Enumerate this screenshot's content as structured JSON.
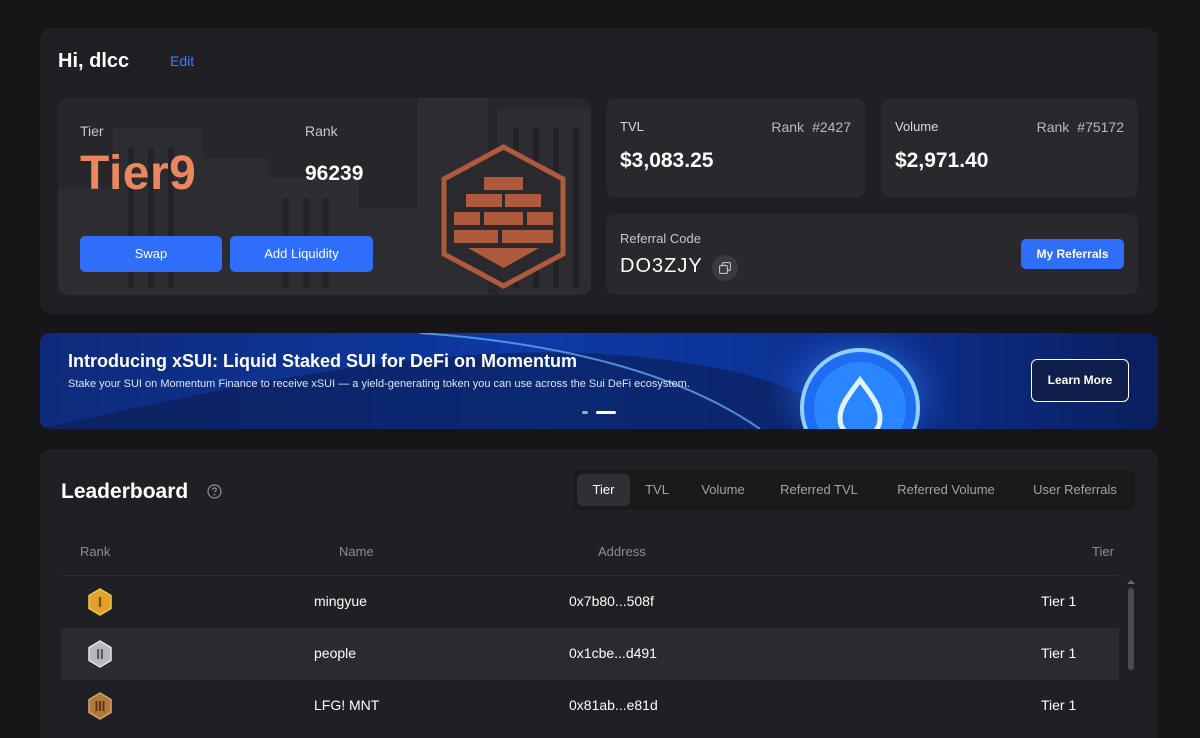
{
  "profile": {
    "greeting": "Hi, dlcc",
    "edit_label": "Edit",
    "tier_label": "Tier",
    "tier_value": "Tier9",
    "rank_label": "Rank",
    "rank_value": "96239",
    "swap_label": "Swap",
    "add_liquidity_label": "Add Liquidity"
  },
  "tvl": {
    "label": "TVL",
    "rank_label": "Rank",
    "rank_value": "#2427",
    "value": "$3,083.25"
  },
  "volume": {
    "label": "Volume",
    "rank_label": "Rank",
    "rank_value": "#75172",
    "value": "$2,971.40"
  },
  "referral": {
    "label": "Referral Code",
    "code": "DO3ZJY",
    "button_label": "My Referrals"
  },
  "banner": {
    "title": "Introducing xSUI: Liquid Staked SUI for DeFi on Momentum",
    "subtitle": "Stake your SUI on Momentum Finance to receive xSUI — a yield-generating token you can use across the Sui DeFi ecosystem.",
    "button_label": "Learn More"
  },
  "leaderboard": {
    "title": "Leaderboard",
    "tabs": [
      "Tier",
      "TVL",
      "Volume",
      "Referred TVL",
      "Referred Volume",
      "User Referrals"
    ],
    "active_tab": "Tier",
    "columns": [
      "Rank",
      "Name",
      "Address",
      "Tier"
    ],
    "rows": [
      {
        "medal": "gold-medal-icon",
        "name": "mingyue",
        "address": "0x7b80...508f",
        "tier": "Tier 1"
      },
      {
        "medal": "silver-medal-icon",
        "name": "people",
        "address": "0x1cbe...d491",
        "tier": "Tier 1"
      },
      {
        "medal": "bronze-medal-icon",
        "name": "LFG! MNT",
        "address": "0x81ab...e81d",
        "tier": "Tier 1"
      }
    ]
  },
  "colors": {
    "background": "#161619",
    "panel": "#202024",
    "accent_blue": "#2f6dfb",
    "tier_orange": "#e9875f",
    "edit_blue": "#3f7bff"
  }
}
